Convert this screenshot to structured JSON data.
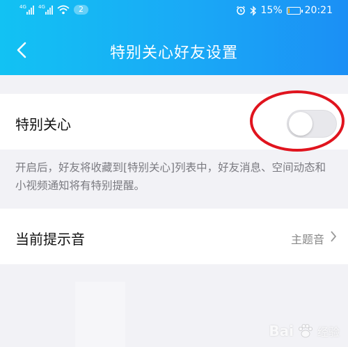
{
  "status_bar": {
    "signal1_label": "4G",
    "signal2_label": "4G",
    "notification_count": "2",
    "battery_percent": "15%",
    "time": "20:21"
  },
  "header": {
    "title": "特别关心好友设置"
  },
  "special_care": {
    "label": "特别关心",
    "toggle_on": false,
    "description": "开启后，好友将收藏到[特别关心]列表中，好友消息、空间动态和小视频通知将有特别提醒。"
  },
  "sound": {
    "label": "当前提示音",
    "value": "主题音"
  },
  "watermark": {
    "brand": "Bai",
    "sub": "经验"
  },
  "colors": {
    "header_start": "#12c2f3",
    "header_end": "#1b8ff5",
    "annotation_red": "#e0141e",
    "battery_low": "#f2b01e"
  }
}
